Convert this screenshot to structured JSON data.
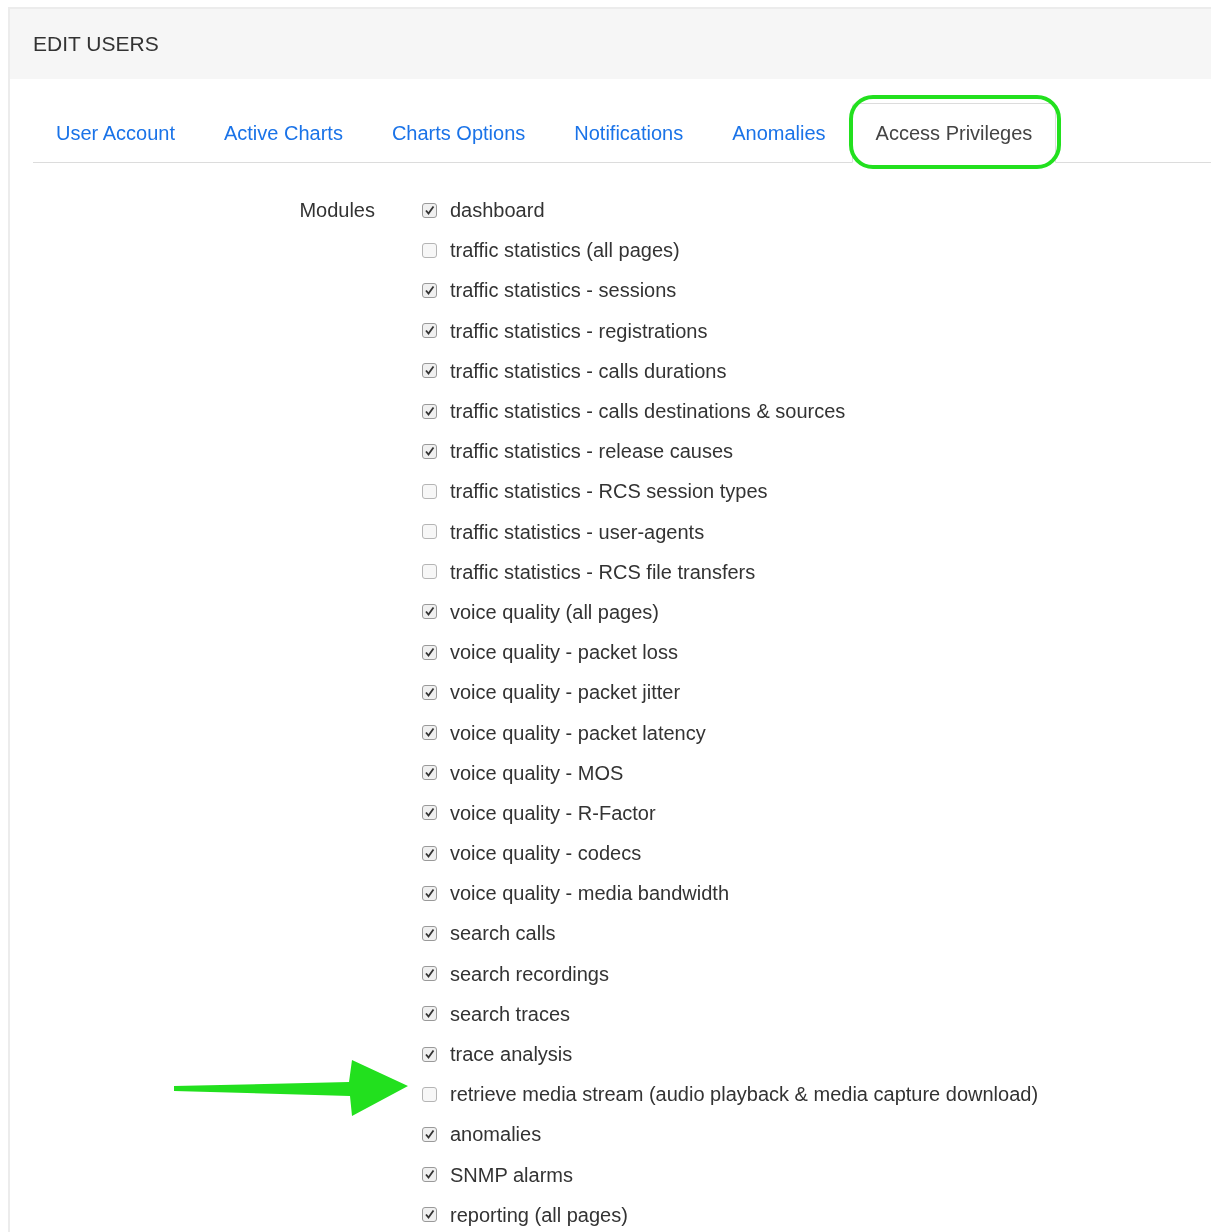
{
  "header": {
    "title": "EDIT USERS"
  },
  "tabs": [
    {
      "label": "User Account",
      "selected": false
    },
    {
      "label": "Active Charts",
      "selected": false
    },
    {
      "label": "Charts Options",
      "selected": false
    },
    {
      "label": "Notifications",
      "selected": false
    },
    {
      "label": "Anomalies",
      "selected": false
    },
    {
      "label": "Access Privileges",
      "selected": true,
      "highlighted": true
    }
  ],
  "modules": {
    "label": "Modules",
    "items": [
      {
        "label": "dashboard",
        "checked": true
      },
      {
        "label": "traffic statistics (all pages)",
        "checked": false
      },
      {
        "label": "traffic statistics - sessions",
        "checked": true
      },
      {
        "label": "traffic statistics - registrations",
        "checked": true
      },
      {
        "label": "traffic statistics - calls durations",
        "checked": true
      },
      {
        "label": "traffic statistics - calls destinations & sources",
        "checked": true
      },
      {
        "label": "traffic statistics - release causes",
        "checked": true
      },
      {
        "label": "traffic statistics - RCS session types",
        "checked": false
      },
      {
        "label": "traffic statistics - user-agents",
        "checked": false
      },
      {
        "label": "traffic statistics - RCS file transfers",
        "checked": false
      },
      {
        "label": "voice quality (all pages)",
        "checked": true
      },
      {
        "label": "voice quality - packet loss",
        "checked": true
      },
      {
        "label": "voice quality - packet jitter",
        "checked": true
      },
      {
        "label": "voice quality - packet latency",
        "checked": true
      },
      {
        "label": "voice quality - MOS",
        "checked": true
      },
      {
        "label": "voice quality - R-Factor",
        "checked": true
      },
      {
        "label": "voice quality - codecs",
        "checked": true
      },
      {
        "label": "voice quality - media bandwidth",
        "checked": true
      },
      {
        "label": "search calls",
        "checked": true
      },
      {
        "label": "search recordings",
        "checked": true
      },
      {
        "label": "search traces",
        "checked": true
      },
      {
        "label": "trace analysis",
        "checked": true
      },
      {
        "label": "retrieve media stream (audio playback & media capture download)",
        "checked": false,
        "arrow": true
      },
      {
        "label": "anomalies",
        "checked": true
      },
      {
        "label": "SNMP alarms",
        "checked": true
      },
      {
        "label": "reporting (all pages)",
        "checked": true
      }
    ]
  }
}
